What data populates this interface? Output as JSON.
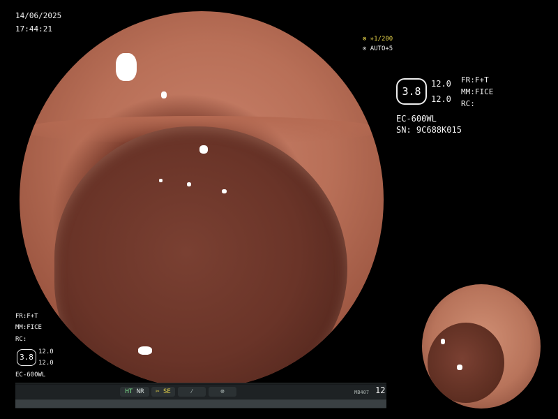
{
  "overlay": {
    "date": "14/06/2025",
    "time": "17:44:21",
    "shutter": "1/200",
    "auto": "AUTO+5"
  },
  "right_panel": {
    "enhance_value": "3.8",
    "val_top": "12.0",
    "val_bottom": "12.0",
    "fr": "FR:F+T",
    "mm": "MM:FICE",
    "rc": "RC:",
    "model": "EC-600WL",
    "serial": "SN: 9C688K015"
  },
  "left_panel": {
    "fr": "FR:F+T",
    "mm": "MM:FICE",
    "rc": "RC:",
    "enhance_value": "3.8",
    "val_top": "12.0",
    "val_bottom": "12.0",
    "model": "EC-600WL"
  },
  "status_bar": {
    "ht": "HT",
    "nr": "NR",
    "se": "SE",
    "code": "MB407",
    "number": "12"
  },
  "icons": {
    "shutter": "aperture-icon",
    "auto": "camera-icon",
    "se": "scissors-icon",
    "slash": "lightning-icon",
    "circle": "record-icon"
  }
}
